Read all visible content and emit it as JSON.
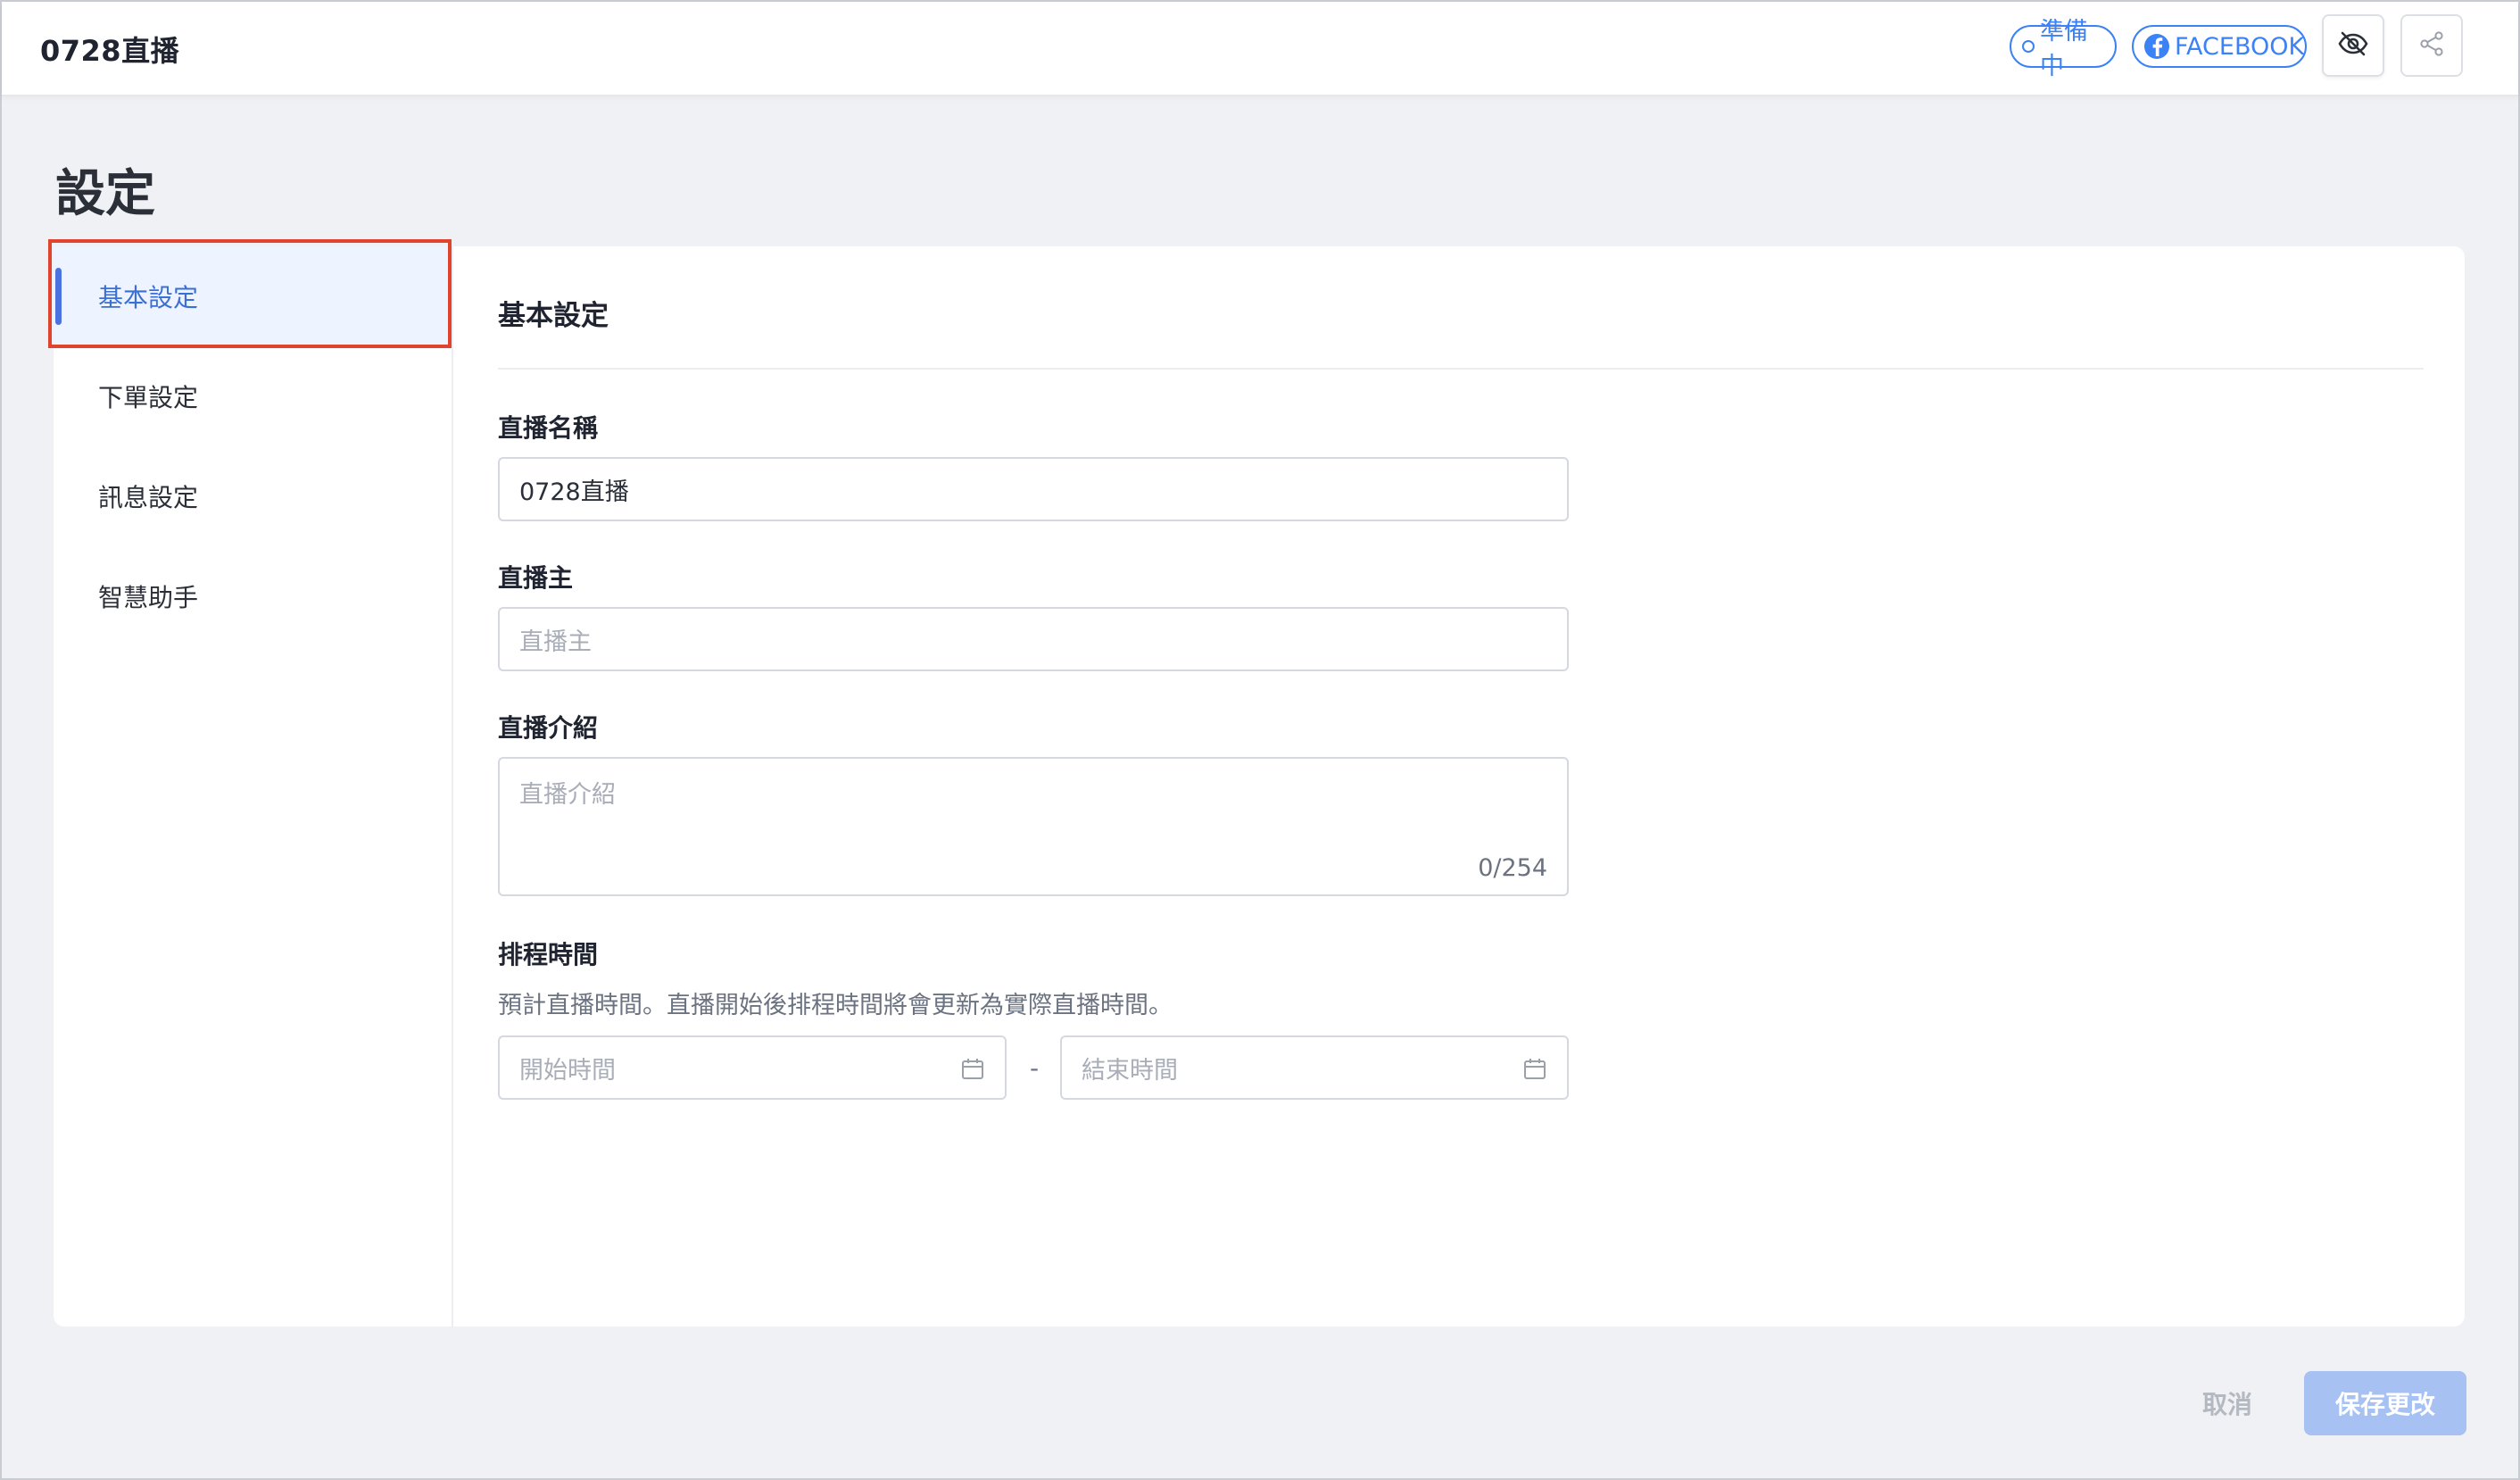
{
  "header": {
    "live_title": "0728直播",
    "status_label": "準備中",
    "platform_label": "FACEBOOK",
    "icons": [
      "eye-off-icon",
      "share-icon"
    ]
  },
  "page": {
    "title": "設定"
  },
  "sidebar": {
    "items": [
      {
        "label": "基本設定",
        "active": true
      },
      {
        "label": "下單設定",
        "active": false
      },
      {
        "label": "訊息設定",
        "active": false
      },
      {
        "label": "智慧助手",
        "active": false
      }
    ]
  },
  "form": {
    "section_title": "基本設定",
    "live_name": {
      "label": "直播名稱",
      "value": "0728直播"
    },
    "host": {
      "label": "直播主",
      "placeholder": "直播主",
      "value": ""
    },
    "intro": {
      "label": "直播介紹",
      "placeholder": "直播介紹",
      "counter": "0/254"
    },
    "schedule": {
      "label": "排程時間",
      "helper": "預計直播時間。直播開始後排程時間將會更新為實際直播時間。",
      "start_placeholder": "開始時間",
      "end_placeholder": "結束時間",
      "separator": "-"
    }
  },
  "footer": {
    "cancel_label": "取消",
    "save_label": "保存更改"
  },
  "colors": {
    "accent": "#3b82f6",
    "active_nav_bg": "#eef4ff",
    "highlight": "#e0442f",
    "save_button_disabled": "#a7c2f2"
  }
}
